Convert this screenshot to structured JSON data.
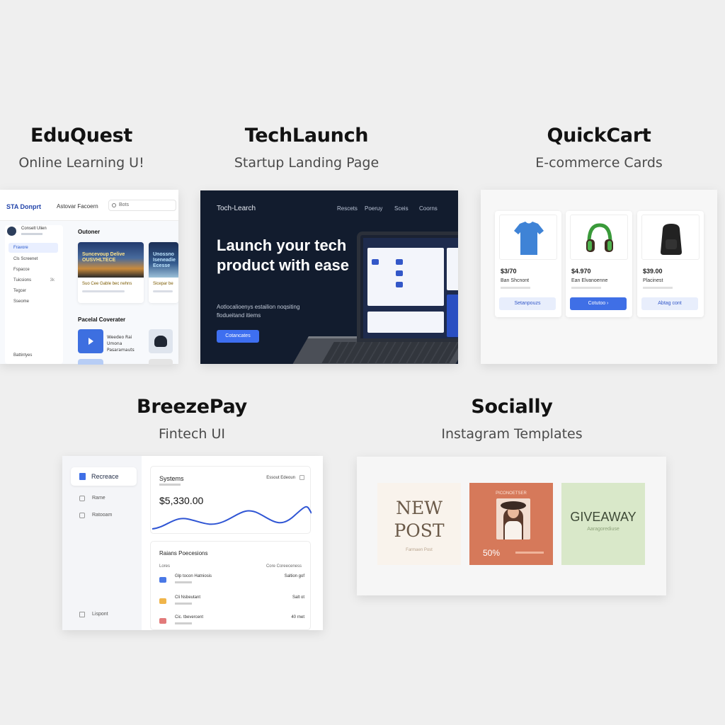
{
  "headings": [
    {
      "title": "EduQuest",
      "subtitle": "Online Learning U!"
    },
    {
      "title": "TechLaunch",
      "subtitle": "Startup Landing Page"
    },
    {
      "title": "QuickCart",
      "subtitle": "E-commerce Cards"
    },
    {
      "title": "BreezePay",
      "subtitle": "Fintech UI"
    },
    {
      "title": "Socially",
      "subtitle": "Instagram Templates"
    }
  ],
  "eduquest": {
    "brand": "STA Donprt",
    "nav_label": "Astovar Facoern",
    "search_placeholder": "Bots",
    "user_name": "Conselt Ulien",
    "nav": [
      {
        "label": "Fravore",
        "active": true
      },
      {
        "label": "Cls Screenet"
      },
      {
        "label": "Fspacce"
      },
      {
        "label": "Tuicsions",
        "count": "3k"
      },
      {
        "label": "Tegcer"
      },
      {
        "label": "Sseome"
      }
    ],
    "settings": "Battintyes",
    "courses_heading": "Outoner",
    "courses": [
      {
        "title": "Suncevoup Delive OUSVHLTECE",
        "meta": "Suo Cee Gable bec nehns"
      },
      {
        "title": "Unossno Iseneadie Ecesse",
        "meta": "Sicepar be"
      }
    ],
    "popular_heading": "Pacelal Coverater",
    "popular_item": "Weedeo Rai Umona Pasaramauts"
  },
  "techlaunch": {
    "brand": "Toch-Learch",
    "nav": [
      "Rescets",
      "Poeruy",
      "Sceis",
      "Coorns"
    ],
    "headline": "Launch your tech product with ease",
    "subtext": "Aotlocalioenys estailion noqsiting flodueitand itiems",
    "cta": "Cotancates"
  },
  "quickcart": {
    "products": [
      {
        "price": "$3/70",
        "name": "Ban Shcnont",
        "button": "Setanpouzs",
        "primary": false,
        "icon": "tshirt-icon"
      },
      {
        "price": "$4.970",
        "name": "Ean Elvanoenne",
        "button": "Cotutoo ›",
        "primary": true,
        "icon": "headphones-icon"
      },
      {
        "price": "$39.00",
        "name": "Placinest",
        "button": "Abtag cont",
        "primary": false,
        "icon": "backpack-icon"
      }
    ]
  },
  "breezepay": {
    "nav_active": "Recreace",
    "nav": [
      "Rame",
      "Ratooam"
    ],
    "logout": "Lispont",
    "balance_title": "Systems",
    "balance": "$5,330.00",
    "filter": "Essout Edeoun",
    "tx_title": "Raians Poecesions",
    "tx_cols": [
      "Lores",
      "Core Coreeceness"
    ],
    "transactions": [
      {
        "name": "Glp tocon Hatniosis",
        "amount": "Saltion gof",
        "color": "#4a78e6"
      },
      {
        "name": "Cli Nsbeutant",
        "amount": "Salt ot",
        "color": "#f0b54a"
      },
      {
        "name": "Cic. tbevercent",
        "amount": "40 rnet",
        "color": "#e27a7a"
      }
    ]
  },
  "socially": {
    "posts": [
      {
        "headline": "NEW POST",
        "small": "Farmaen Post"
      },
      {
        "top": "PICONOETSER",
        "pct": "50%"
      },
      {
        "headline": "GIVEAWAY",
        "small": "Aaragorediuse"
      }
    ]
  }
}
